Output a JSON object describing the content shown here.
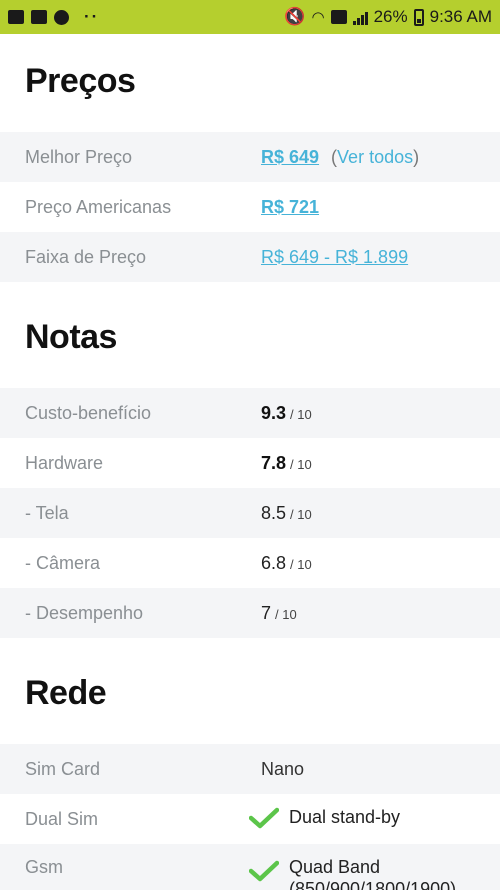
{
  "status_bar": {
    "battery_percent": "26%",
    "time": "9:36 AM",
    "dots": "··"
  },
  "precos": {
    "title": "Preços",
    "rows": [
      {
        "label": "Melhor Preço",
        "value": "R$ 649",
        "extra_open": "(",
        "extra_link": "Ver todos",
        "extra_close": ")"
      },
      {
        "label": "Preço Americanas",
        "value": "R$ 721"
      },
      {
        "label": "Faixa de Preço",
        "value": "R$ 649 - R$ 1.899"
      }
    ]
  },
  "notas": {
    "title": "Notas",
    "out_of": "/ 10",
    "rows": [
      {
        "label": "Custo-benefício",
        "score": "9.3"
      },
      {
        "label": "Hardware",
        "score": "7.8"
      },
      {
        "label": "- Tela",
        "score": "8.5"
      },
      {
        "label": "- Câmera",
        "score": "6.8"
      },
      {
        "label": "- Desempenho",
        "score": "7"
      }
    ]
  },
  "rede": {
    "title": "Rede",
    "rows": [
      {
        "label": "Sim Card",
        "value": "Nano"
      },
      {
        "label": "Dual Sim",
        "value": "Dual stand-by"
      },
      {
        "label": "Gsm",
        "value": "Quad Band",
        "value2": "(850/900/1800/1900)"
      }
    ]
  },
  "colors": {
    "status_bar": "#b5cf2e",
    "link": "#46b3d8",
    "check": "#5cc54a",
    "row_shade": "#f4f5f7"
  }
}
